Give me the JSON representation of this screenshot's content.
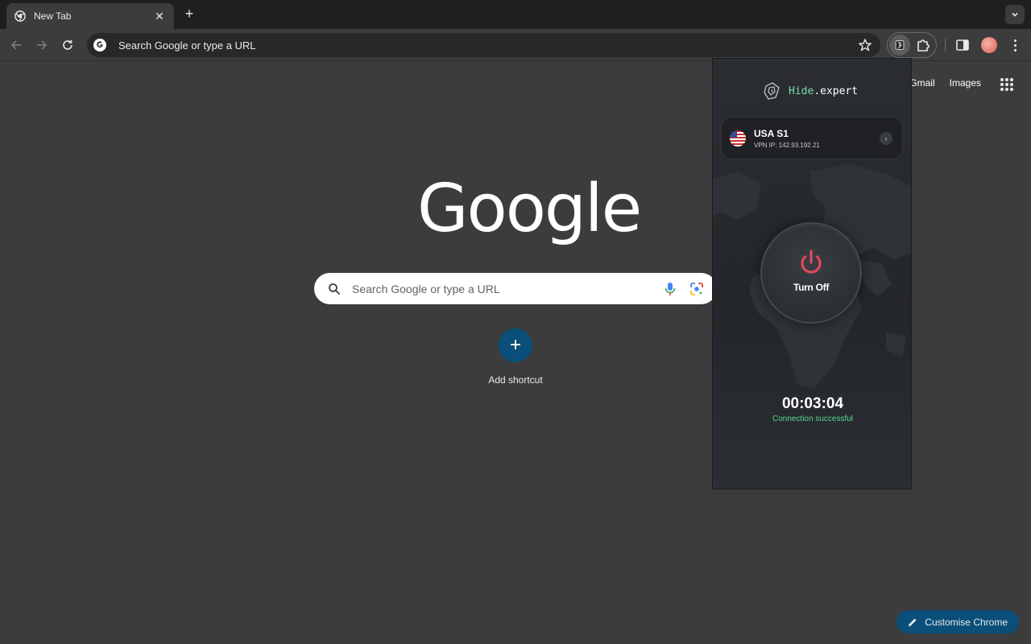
{
  "tab": {
    "title": "New Tab",
    "close_glyph": "✕"
  },
  "toolbar": {
    "new_tab_glyph": "+",
    "omnibox_text": "Search Google or type a URL"
  },
  "ntp": {
    "header_links": [
      "Gmail",
      "Images"
    ],
    "logo": "Google",
    "search_placeholder": "Search Google or type a URL",
    "add_shortcut_glyph": "+",
    "add_shortcut_label": "Add shortcut",
    "customise_label": "Customise Chrome"
  },
  "vpn": {
    "brand_prefix": "Hide",
    "brand_suffix": ".expert",
    "server_name": "USA S1",
    "server_ip": "VPN IP: 142.93.192.21",
    "arrow_glyph": "›",
    "power_label": "Turn Off",
    "timer": "00:03:04",
    "status": "Connection successful"
  },
  "colors": {
    "page_bg": "#3c3c3c",
    "tabstrip_bg": "#1f1f1f",
    "brand_accent": "#77e0a6",
    "status_green": "#58d68d",
    "power_red": "#e0495a",
    "customise_bg": "#0a4f79"
  },
  "icons": [
    "chrome-icon",
    "back-icon",
    "forward-icon",
    "reload-icon",
    "google-g-icon",
    "star-icon",
    "vpn-extension-icon",
    "puzzle-icon",
    "side-panel-icon",
    "avatar",
    "kebab-menu-icon",
    "apps-grid-icon",
    "search-icon",
    "mic-icon",
    "lens-icon",
    "pencil-icon",
    "power-icon",
    "hide-expert-logo-icon",
    "us-flag-icon"
  ]
}
